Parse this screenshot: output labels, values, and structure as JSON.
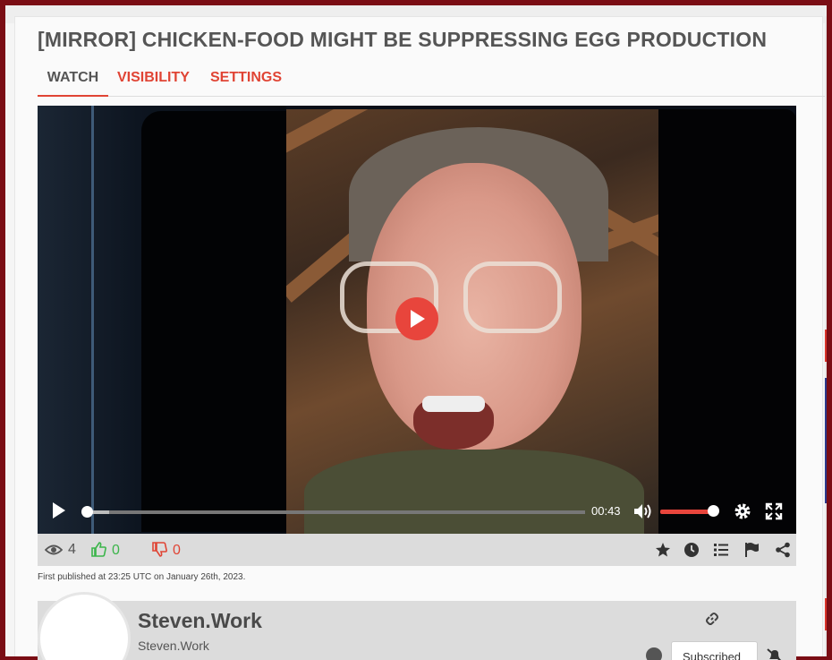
{
  "video": {
    "title": "[MIRROR] CHICKEN-FOOD MIGHT BE SUPPRESSING EGG PRODUCTION",
    "current_time": "00:43",
    "progress_fraction": 0.05,
    "volume_fraction": 0.85
  },
  "tabs": [
    {
      "label": "WATCH",
      "active": true
    },
    {
      "label": "VISIBILITY",
      "active": false
    },
    {
      "label": "SETTINGS",
      "active": false
    }
  ],
  "stats": {
    "views": "4",
    "likes": "0",
    "dislikes": "0"
  },
  "published": "First published at 23:25 UTC on January 26th, 2023.",
  "channel": {
    "name": "Steven.Work",
    "handle": "Steven.Work",
    "subscribe_label": "Subscribed"
  },
  "icons": {
    "views": "eye-icon",
    "like": "thumbs-up-icon",
    "dislike": "thumbs-down-icon",
    "actions": [
      "star-icon",
      "clock-icon",
      "list-icon",
      "flag-icon",
      "share-icon"
    ]
  },
  "colors": {
    "accent": "#e04434",
    "frame": "#7a0d14",
    "like": "#3bb54a"
  }
}
